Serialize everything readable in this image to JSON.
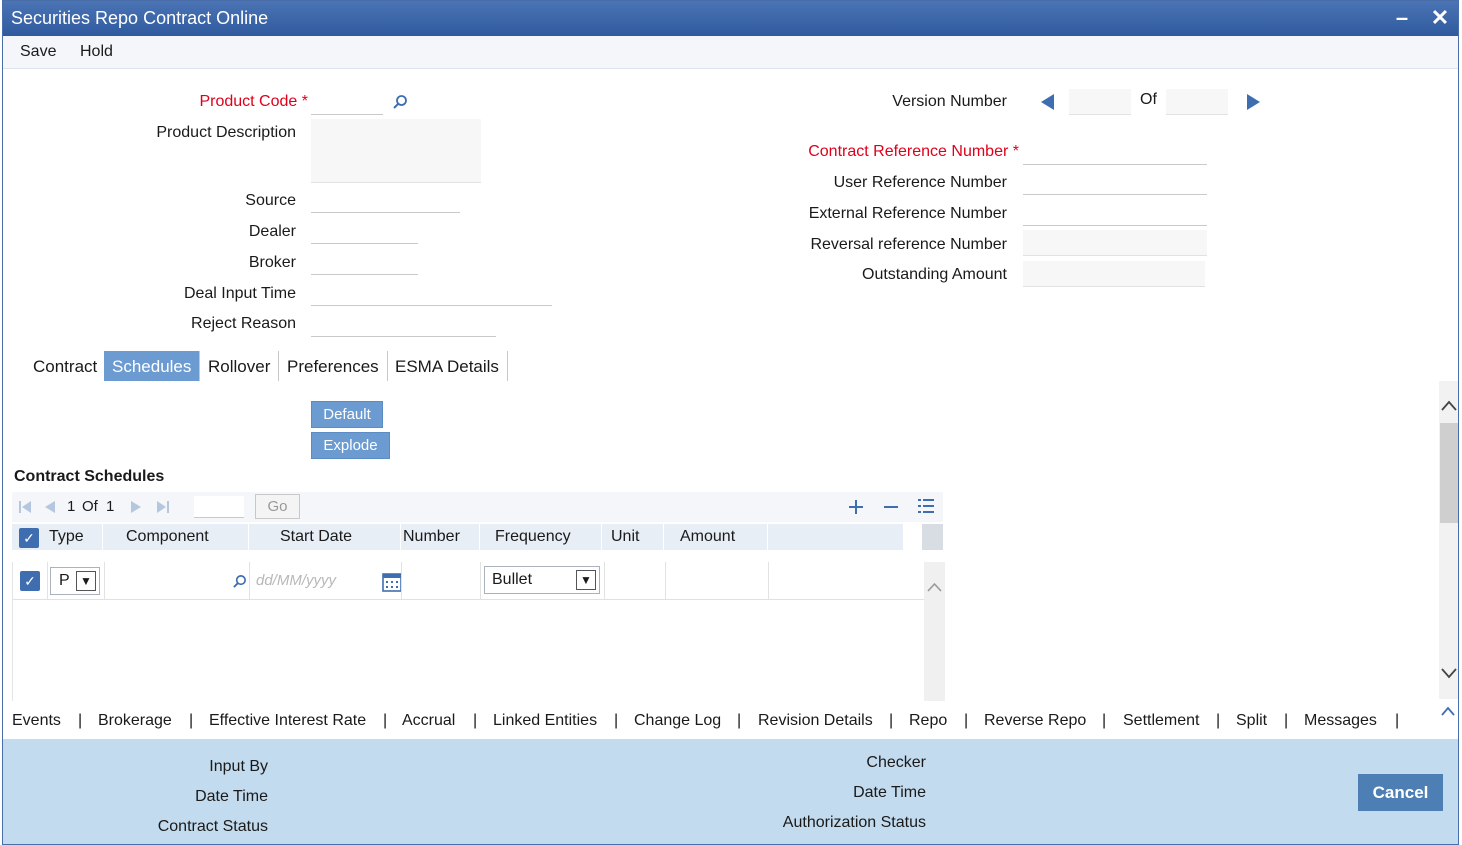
{
  "window": {
    "title": "Securities Repo Contract Online"
  },
  "menu": {
    "save": "Save",
    "hold": "Hold"
  },
  "form": {
    "product_code_label": "Product Code",
    "product_description_label": "Product Description",
    "source_label": "Source",
    "dealer_label": "Dealer",
    "broker_label": "Broker",
    "deal_input_time_label": "Deal Input Time",
    "reject_reason_label": "Reject Reason",
    "version_number_label": "Version Number",
    "of_label": "Of",
    "contract_ref_label": "Contract Reference Number",
    "user_ref_label": "User Reference Number",
    "external_ref_label": "External Reference Number",
    "reversal_ref_label": "Reversal reference Number",
    "outstanding_amount_label": "Outstanding Amount",
    "required_mark": "*"
  },
  "tabs": [
    "Contract",
    "Schedules",
    "Rollover",
    "Preferences",
    "ESMA Details"
  ],
  "actions": {
    "default": "Default",
    "explode": "Explode"
  },
  "schedules": {
    "title": "Contract Schedules",
    "pager": {
      "current": "1",
      "of": "Of",
      "total": "1",
      "go": "Go"
    },
    "columns": [
      "Type",
      "Component",
      "Start Date",
      "Number",
      "Frequency",
      "Unit",
      "Amount"
    ],
    "row": {
      "type": "P",
      "start_date_placeholder": "dd/MM/yyyy",
      "frequency": "Bullet"
    }
  },
  "links": [
    "Events",
    "Brokerage",
    "Effective Interest Rate",
    "Accrual",
    "Linked Entities",
    "Change Log",
    "Revision Details",
    "Repo",
    "Reverse Repo",
    "Settlement",
    "Split",
    "Messages"
  ],
  "link_separator": "|",
  "footer": {
    "input_by": "Input By",
    "date_time": "Date Time",
    "contract_status": "Contract Status",
    "checker": "Checker",
    "date_time_2": "Date Time",
    "authorization_status": "Authorization Status",
    "cancel": "Cancel"
  }
}
